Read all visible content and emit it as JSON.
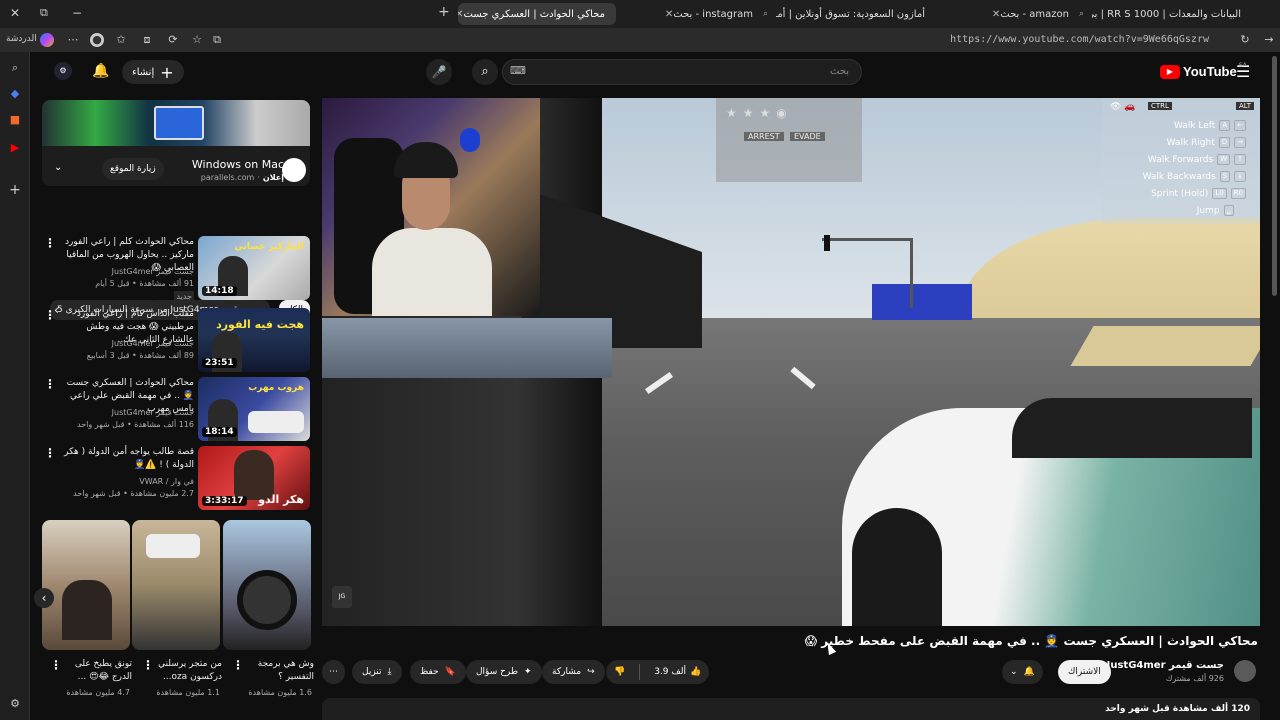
{
  "browser": {
    "tabs": [
      {
        "title": "البيانات والمعدات | 1000 RR S | بي",
        "active": false
      },
      {
        "title": "amazon - بحث",
        "active": false
      },
      {
        "title": "أمازون السعودية: تسوق أونلاين | أمـ",
        "active": false
      },
      {
        "title": "instagram - بحث",
        "active": false
      },
      {
        "title": "محاكي الحوادث | العسكري جست",
        "active": true
      }
    ],
    "new_tab": "+",
    "url": "https://www.youtube.com/watch?v=9We66qGszrw",
    "profile_label": "الدردشة"
  },
  "youtube": {
    "logo": "YouTube",
    "logo_region": "SA",
    "search_placeholder": "بحث",
    "create_label": "إنشاء",
    "brand_red": "#ff0000"
  },
  "ad": {
    "title": "Windows on Mac",
    "sponsored": "إعلان",
    "domain": "parallels.com",
    "cta": "زيارة الموقع"
  },
  "chips": [
    {
      "label": "الكل",
      "selected": true
    },
    {
      "label": "من JustG4mer جست قيمر",
      "selected": false
    },
    {
      "label": "سرعة السيارات الكبرى 5",
      "selected": false
    }
  ],
  "recommendations": [
    {
      "title": "محاكي الحوادث كلم | راعي الفورد ماركيز .. يحاول الهروب من المافيا العصابي 😱",
      "channel": "جست قيمر JustG4mer",
      "meta": "91 ألف مشاهدة • قبل 5 أيام",
      "badge": "جديد",
      "duration": "14:18",
      "thumb_text": "الماركيز عصابي"
    },
    {
      "title": "مقلب الداش كام | راعي الفورد مرطبيني 😱 هجت فيه وطش عالشارع الثاني عك..",
      "channel": "جست قيمر JustG4mer",
      "meta": "89 ألف مشاهدة • قبل 3 أسابيع",
      "badge": "",
      "duration": "23:51",
      "thumb_text": "هجت فيه الفورد"
    },
    {
      "title": "محاكي الحوادث | العسكري جست 👮 .. في مهمة القبض علي راعي يامس مهرب ..",
      "channel": "جست قيمر JustG4mer",
      "meta": "116 ألف مشاهدة • قبل شهر واحد",
      "badge": "",
      "duration": "18:14",
      "thumb_text": "هروب مهرب"
    },
    {
      "title": "قصة طالب يواجه أمن الدولة ( هكر الدولة ) ! ⚠️👮",
      "channel": "في وار / VWAR",
      "meta": "2.7 مليون مشاهدة • قبل شهر واحد",
      "badge": "",
      "duration": "3:33:17",
      "thumb_text": "هكر الدو"
    }
  ],
  "shorts": [
    {
      "title": "تونق يطبخ على الدرج 😂😍 ...",
      "views": "4.7 مليون مشاهدة"
    },
    {
      "title": "من متجر يرسلني دركسون oza...",
      "views": "1.1 مليون مشاهدة"
    },
    {
      "title": "وش هي برمجة التفسير ؟",
      "views": "1.6 مليون مشاهدة"
    }
  ],
  "video": {
    "title": "محاكي الحوادث | العسكري جست 👮 .. في مهمة القبض على مفحط خطير 😱",
    "channel": "جست قيمر JustG4mer",
    "subscribers": "926 ألف مشترك",
    "subscribe_label": "الاشتراك",
    "likes": "3.9 ألف",
    "share_label": "مشاركة",
    "ask_label": "طرح سؤال",
    "save_label": "حفظ",
    "download_label": "تنزيل",
    "views_line": "120 ألف مشاهدة قبل شهر واحد",
    "hud_buttons": [
      "ARREST",
      "EVADE"
    ],
    "controls_header": [
      "CTRL",
      "ALT"
    ],
    "controls": [
      {
        "label": "Walk Left",
        "keys": [
          "A",
          "←"
        ]
      },
      {
        "label": "Walk Right",
        "keys": [
          "D",
          "→"
        ]
      },
      {
        "label": "Walk Forwards",
        "keys": [
          "W",
          "↑"
        ]
      },
      {
        "label": "Walk Backwards",
        "keys": [
          "S",
          "↓"
        ]
      },
      {
        "label": "Sprint (Hold)",
        "keys": [
          "L0",
          "R0"
        ]
      },
      {
        "label": "Jump",
        "keys": [
          "␣"
        ]
      }
    ]
  }
}
